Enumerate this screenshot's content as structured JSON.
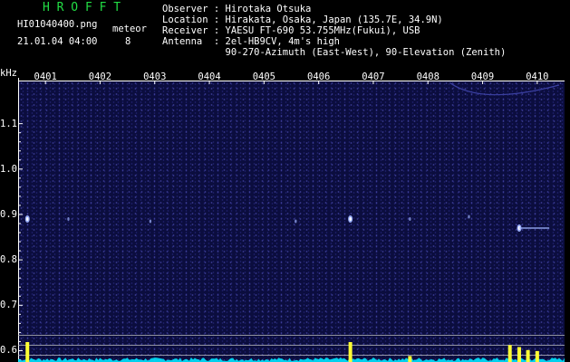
{
  "header": {
    "app_logo": "H R O F F T",
    "file_name": "HI01040400.png",
    "timestamp": "21.01.04 04:00",
    "meteor_label": "meteor",
    "meteor_count": "8",
    "observer_line": "Observer : Hirotaka Otsuka",
    "location_line": "Location : Hirakata, Osaka, Japan (135.7E, 34.9N)",
    "receiver_line": "Receiver : YAESU FT-690 53.755MHz(Fukui), USB",
    "antenna_line": "Antenna  : 2el-HB9CV, 4m's high",
    "antenna_detail_line": "           90-270-Azimuth (East-West), 90-Elevation (Zenith)"
  },
  "colors": {
    "logo": "#22dd44",
    "background": "#000000",
    "spectrogram_bg": "#0b0d3e",
    "echo": "#9fb4ff",
    "level_trace": "#00e5ff",
    "level_burst": "#ffff33"
  },
  "chart_data": {
    "type": "heatmap",
    "ylabel": "kHz",
    "x_ticks": [
      "0401",
      "0402",
      "0403",
      "0404",
      "0405",
      "0406",
      "0407",
      "0408",
      "0409",
      "0410"
    ],
    "x_range": [
      0,
      10
    ],
    "y_ticks": [
      "1.1",
      "1.0",
      "0.9",
      "0.8",
      "0.7",
      "0.6"
    ],
    "y_range": [
      0.575,
      1.195
    ],
    "meteor_echoes": [
      {
        "minute": 0.17,
        "freq_khz": 0.89,
        "strength": "strong"
      },
      {
        "minute": 0.92,
        "freq_khz": 0.89,
        "strength": "weak"
      },
      {
        "minute": 2.42,
        "freq_khz": 0.885,
        "strength": "weak"
      },
      {
        "minute": 5.08,
        "freq_khz": 0.885,
        "strength": "weak"
      },
      {
        "minute": 6.08,
        "freq_khz": 0.89,
        "strength": "strong"
      },
      {
        "minute": 7.17,
        "freq_khz": 0.89,
        "strength": "weak"
      },
      {
        "minute": 8.25,
        "freq_khz": 0.895,
        "strength": "weak"
      },
      {
        "minute": 9.17,
        "freq_khz": 0.87,
        "strength": "strong"
      }
    ],
    "level_bursts": [
      {
        "minute": 0.17,
        "level": 1.0
      },
      {
        "minute": 6.08,
        "level": 1.0
      },
      {
        "minute": 7.17,
        "level": 0.3
      },
      {
        "minute": 9.0,
        "level": 0.85
      },
      {
        "minute": 9.17,
        "level": 0.75
      },
      {
        "minute": 9.33,
        "level": 0.6
      },
      {
        "minute": 9.5,
        "level": 0.55
      }
    ]
  }
}
